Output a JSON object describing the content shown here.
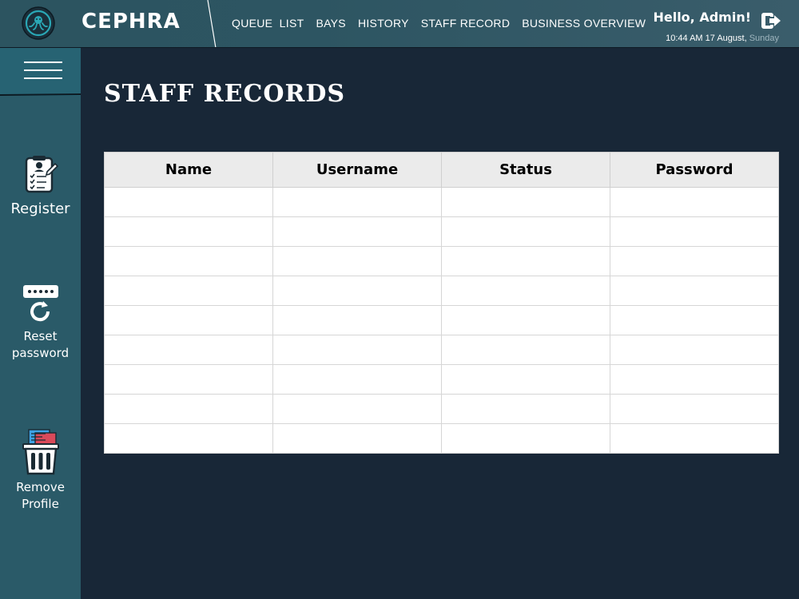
{
  "header": {
    "brand": "CEPHRA",
    "nav": [
      "QUEUE  LIST",
      "BAYS",
      "HISTORY",
      "STAFF RECORD",
      "BUSINESS OVERVIEW"
    ],
    "greeting": "Hello, Admin!",
    "datetime": "10:44 AM 17 August, ",
    "day": "Sunday"
  },
  "sidebar": {
    "register": "Register",
    "reset_line1": "Reset",
    "reset_line2": "password",
    "remove_line1": "Remove",
    "remove_line2": "Profile"
  },
  "main": {
    "title": "STAFF RECORDS",
    "columns": [
      "Name",
      "Username",
      "Status",
      "Password"
    ],
    "rows": [
      [
        "",
        "",
        "",
        ""
      ],
      [
        "",
        "",
        "",
        ""
      ],
      [
        "",
        "",
        "",
        ""
      ],
      [
        "",
        "",
        "",
        ""
      ],
      [
        "",
        "",
        "",
        ""
      ],
      [
        "",
        "",
        "",
        ""
      ],
      [
        "",
        "",
        "",
        ""
      ],
      [
        "",
        "",
        "",
        ""
      ],
      [
        "",
        "",
        "",
        ""
      ]
    ]
  },
  "colors": {
    "background": "#182737",
    "sidebar": "#2a5a68",
    "topbar": "#2d5562"
  },
  "icons": {
    "logo": "octopus-logo-icon",
    "logout": "logout-icon",
    "menu": "hamburger-menu-icon",
    "register": "clipboard-register-icon",
    "reset": "password-reset-icon",
    "remove": "trash-remove-icon"
  }
}
